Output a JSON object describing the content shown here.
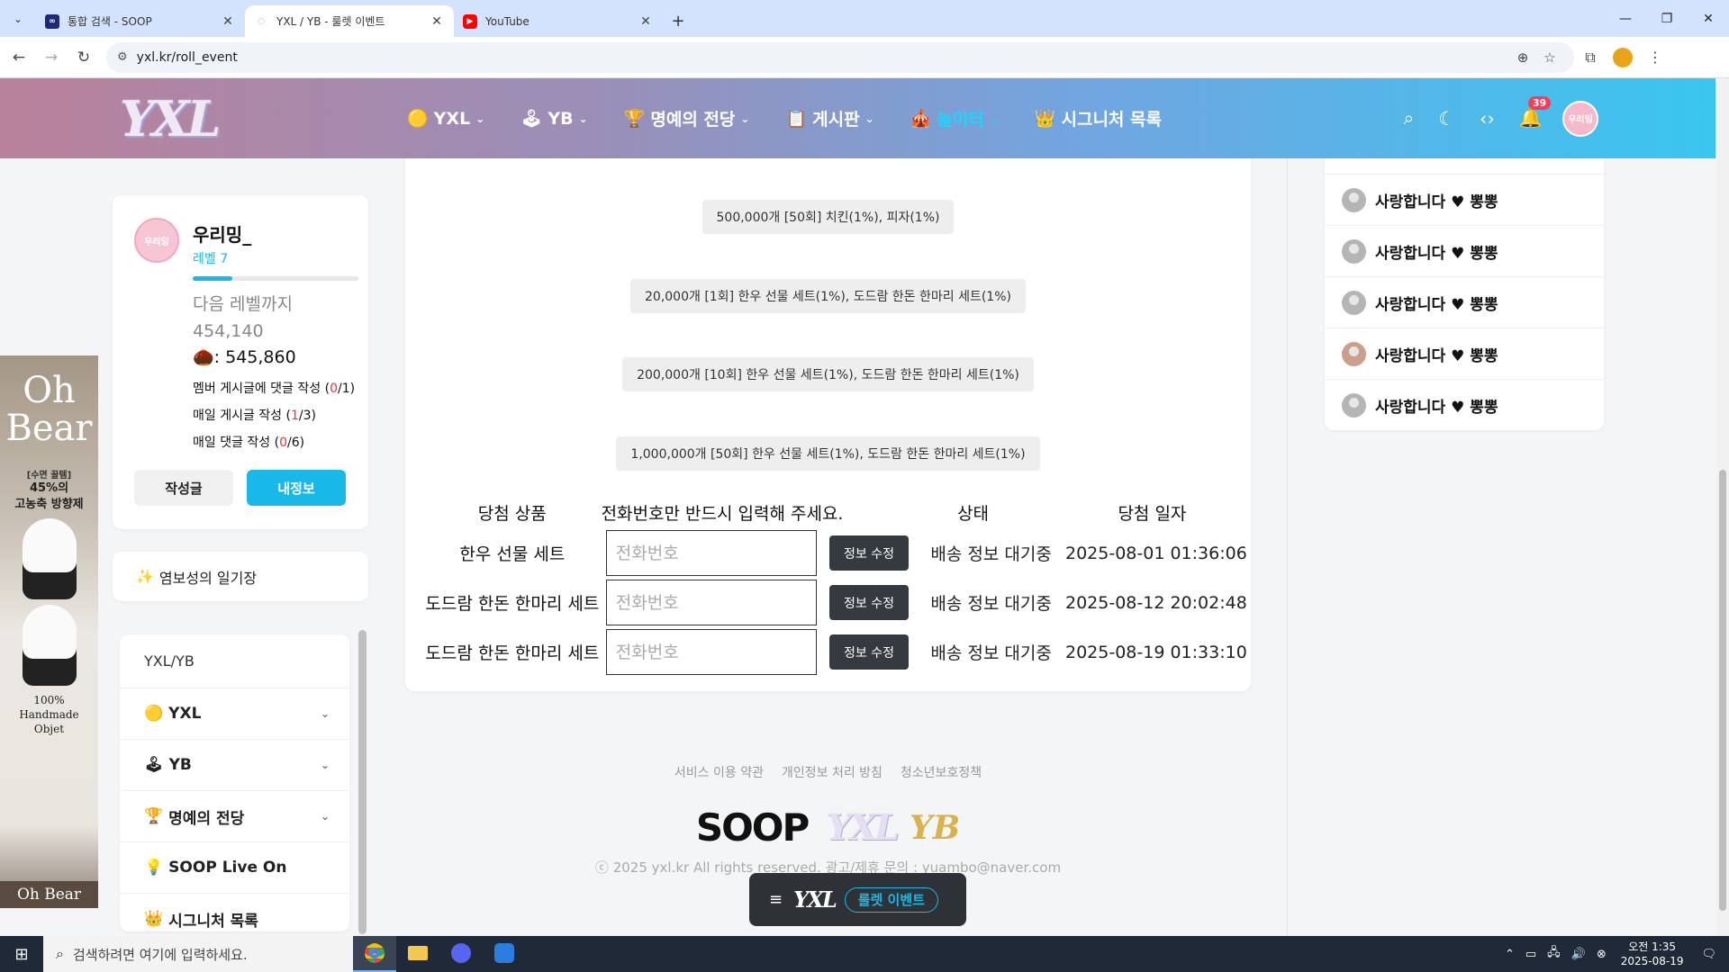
{
  "browser": {
    "tabs": [
      {
        "title": "통합 검색 - SOOP",
        "icon": "soop-favicon",
        "active": false
      },
      {
        "title": "YXL / YB - 룰렛 이벤트",
        "icon": "loading-favicon",
        "active": true
      },
      {
        "title": "YouTube",
        "icon": "youtube-favicon",
        "active": false
      }
    ],
    "url": "yxl.kr/roll_event"
  },
  "header": {
    "logo": "YXL",
    "nav": [
      {
        "label": "YXL",
        "icon": "coin-icon"
      },
      {
        "label": "YB",
        "icon": "joystick-icon"
      },
      {
        "label": "명예의 전당",
        "icon": "trophy-icon"
      },
      {
        "label": "게시판",
        "icon": "board-icon"
      },
      {
        "label": "놀이터",
        "icon": "playground-icon",
        "active": true
      },
      {
        "label": "시그니처 목록",
        "icon": "crown-icon"
      }
    ],
    "notification_count": "39"
  },
  "ad": {
    "brand": "Oh\nBear",
    "sub": "[수면 꿀템]",
    "headline_1": "45%의",
    "headline_2": "고농축 방향제",
    "foot_1": "100%",
    "foot_2": "Handmade",
    "foot_3": "Objet",
    "bottom": "Oh Bear"
  },
  "profile": {
    "name": "우리밍_",
    "level": "레벨 7",
    "level_progress": 0.24,
    "next_label": "다음 레벨까지",
    "next_value": "454,140",
    "points": ": 545,860",
    "quests": [
      {
        "label": "멤버 게시글에 댓글 작성 (",
        "done": "0",
        "total": "/1)"
      },
      {
        "label": "매일 게시글 작성 (",
        "done": "1",
        "total": "/3)"
      },
      {
        "label": "매일 댓글 작성 (",
        "done": "0",
        "total": "/6)"
      }
    ],
    "btn_posts": "작성글",
    "btn_myinfo": "내정보"
  },
  "diary": {
    "label": "염보성의 일기장"
  },
  "sidenav": {
    "head": "YXL/YB",
    "items": [
      {
        "label": "YXL",
        "icon": "coin-icon",
        "expand": true
      },
      {
        "label": "YB",
        "icon": "joystick-icon",
        "expand": true
      },
      {
        "label": "명예의 전당",
        "icon": "trophy-icon",
        "expand": true
      },
      {
        "label": "SOOP Live On",
        "icon": "bulb-icon",
        "expand": false
      },
      {
        "label": "시그니처 목록",
        "icon": "crown-icon",
        "expand": false
      }
    ]
  },
  "prizes": [
    "500,000개 [50회] 치킨(1%), 피자(1%)",
    "20,000개 [1회] 한우 선물 세트(1%), 도드람 한돈 한마리 세트(1%)",
    "200,000개 [10회] 한우 선물 세트(1%), 도드람 한돈 한마리 세트(1%)",
    "1,000,000개 [50회] 한우 선물 세트(1%), 도드람 한돈 한마리 세트(1%)"
  ],
  "winners": {
    "headers": {
      "prize": "당첨 상품",
      "phone": "전화번호만 반드시 입력해 주세요.",
      "status": "상태",
      "date": "당첨 일자"
    },
    "phone_placeholder": "전화번호",
    "edit_label": "정보 수정",
    "rows": [
      {
        "prize": "한우 선물 세트",
        "status": "배송 정보 대기중",
        "date": "2025-08-01 01:36:06"
      },
      {
        "prize": "도드람 한돈 한마리 세트",
        "status": "배송 정보 대기중",
        "date": "2025-08-12 20:02:48"
      },
      {
        "prize": "도드람 한돈 한마리 세트",
        "status": "배송 정보 대기중",
        "date": "2025-08-19 01:33:10"
      }
    ]
  },
  "right_list": [
    {
      "text": "사랑합니다 ♥ 뽕뽕",
      "avatar": "default"
    },
    {
      "text": "사랑합니다 ♥ 뽕뽕",
      "avatar": "default"
    },
    {
      "text": "사랑합니다 ♥ 뽕뽕",
      "avatar": "default"
    },
    {
      "text": "사랑합니다 ♥ 뽕뽕",
      "avatar": "photo"
    },
    {
      "text": "사랑합니다 ♥ 뽕뽕",
      "avatar": "default"
    }
  ],
  "footer": {
    "links": [
      "서비스 이용 약관",
      "개인정보 처리 방침",
      "청소년보호정책"
    ],
    "logo_soop": "SOOP",
    "logo_yxl": "YXL",
    "logo_yb": "YB",
    "copyright": "ⓒ 2025 yxl.kr All rights reserved. 광고/제휴 문의 : yuambo@naver.com"
  },
  "floating": {
    "logo": "YXL",
    "pill": "룰렛 이벤트"
  },
  "taskbar": {
    "search_placeholder": "검색하려면 여기에 입력하세요.",
    "time": "오전 1:35",
    "date": "2025-08-19"
  },
  "colors": {
    "accent": "#18b8e8",
    "quest_count": "#e8373f"
  }
}
